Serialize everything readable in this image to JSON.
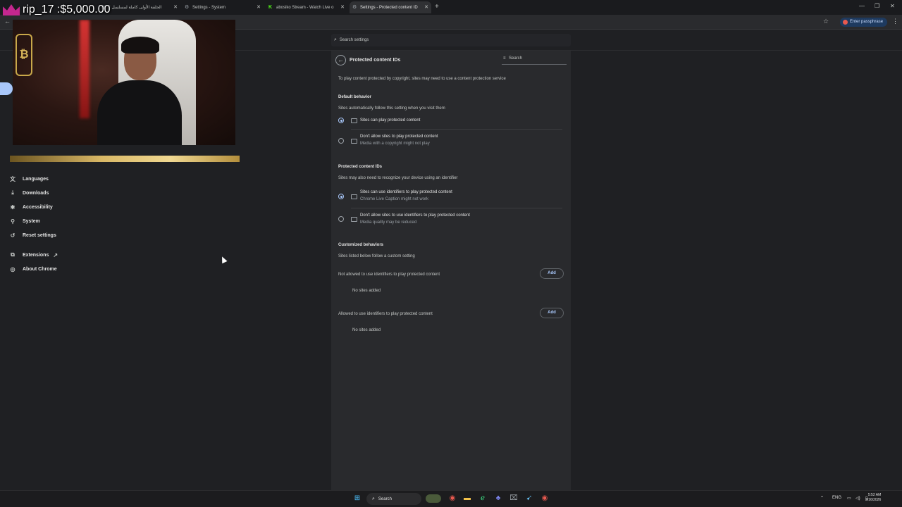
{
  "tabs": [
    {
      "label": "الحلقة الأولى كاملة لمسلسل ا",
      "active": false
    },
    {
      "label": "Settings - System",
      "active": false
    },
    {
      "label": "abosiko Stream - Watch Live o",
      "active": false
    },
    {
      "label": "Settings - Protected content ID",
      "active": true
    }
  ],
  "toolbar": {
    "passphrase_label": "Enter passphrase"
  },
  "settings_search": {
    "placeholder": "Search settings"
  },
  "sidebar": {
    "items": [
      {
        "label": "Languages",
        "icon": "translate-icon"
      },
      {
        "label": "Downloads",
        "icon": "download-icon"
      },
      {
        "label": "Accessibility",
        "icon": "accessibility-icon"
      },
      {
        "label": "System",
        "icon": "wrench-icon"
      },
      {
        "label": "Reset settings",
        "icon": "reset-icon"
      },
      {
        "label": "Extensions",
        "icon": "puzzle-icon"
      },
      {
        "label": "About Chrome",
        "icon": "chrome-icon"
      }
    ]
  },
  "overlay": {
    "donation_text": "rip_17 :$5,000.00"
  },
  "panel": {
    "title": "Protected content IDs",
    "search_placeholder": "Search",
    "intro": "To play content protected by copyright, sites may need to use a content protection service",
    "default_behavior": {
      "heading": "Default behavior",
      "sub": "Sites automatically follow this setting when you visit them",
      "options": [
        {
          "main": "Sites can play protected content",
          "sub": "",
          "selected": true
        },
        {
          "main": "Don't allow sites to play protected content",
          "sub": "Media with a copyright might not play",
          "selected": false
        }
      ]
    },
    "protected_ids": {
      "heading": "Protected content IDs",
      "sub": "Sites may also need to recognize your device using an identifier",
      "options": [
        {
          "main": "Sites can use identifiers to play protected content",
          "sub": "Chrome Live Caption might not work",
          "selected": true
        },
        {
          "main": "Don't allow sites to use identifiers to play protected content",
          "sub": "Media quality may be reduced",
          "selected": false
        }
      ]
    },
    "customized": {
      "heading": "Customized behaviors",
      "sub": "Sites listed below follow a custom setting",
      "not_allowed_label": "Not allowed to use identifiers to play protected content",
      "allowed_label": "Allowed to use identifiers to play protected content",
      "add_label": "Add",
      "empty_label": "No sites added"
    }
  },
  "taskbar": {
    "search_label": "Search",
    "lang": "ENG",
    "time": "5:52 AM",
    "date": "3/16/2026"
  },
  "colors": {
    "accent": "#a8c7fa",
    "background": "#1f2023",
    "panel": "#292a2d"
  }
}
